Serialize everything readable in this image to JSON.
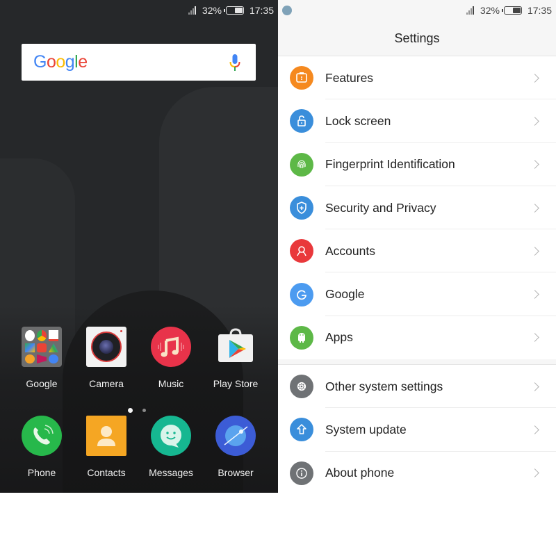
{
  "home": {
    "status": {
      "battery": "32%",
      "battery_level": 0.32,
      "time": "17:35"
    },
    "search": {
      "logo": [
        "G",
        "o",
        "o",
        "g",
        "l",
        "e"
      ],
      "logo_colors": [
        "#4285F4",
        "#EA4335",
        "#FBBC05",
        "#4285F4",
        "#34A853",
        "#EA4335"
      ]
    },
    "apps_row1": [
      {
        "label": "Google",
        "icon": "google-folder-icon"
      },
      {
        "label": "Camera",
        "icon": "camera-icon"
      },
      {
        "label": "Music",
        "icon": "music-icon"
      },
      {
        "label": "Play Store",
        "icon": "play-store-icon"
      }
    ],
    "page_indicator": {
      "current": 1,
      "total": 2
    },
    "dock": [
      {
        "label": "Phone",
        "icon": "phone-icon"
      },
      {
        "label": "Contacts",
        "icon": "contacts-icon"
      },
      {
        "label": "Messages",
        "icon": "messages-icon"
      },
      {
        "label": "Browser",
        "icon": "browser-icon"
      }
    ]
  },
  "settings": {
    "status": {
      "battery": "32%",
      "battery_level": 0.32,
      "time": "17:35"
    },
    "title": "Settings",
    "group1": [
      {
        "label": "Features",
        "icon": "features-icon",
        "color": "#F5891F"
      },
      {
        "label": "Lock screen",
        "icon": "lock-icon",
        "color": "#3A8EDB"
      },
      {
        "label": "Fingerprint Identification",
        "icon": "fingerprint-icon",
        "color": "#5DB847"
      },
      {
        "label": "Security and Privacy",
        "icon": "shield-icon",
        "color": "#3A8EDB"
      },
      {
        "label": "Accounts",
        "icon": "account-icon",
        "color": "#E9383B"
      },
      {
        "label": "Google",
        "icon": "google-g-icon",
        "color": "#4C9BF0"
      },
      {
        "label": "Apps",
        "icon": "android-icon",
        "color": "#5DB847"
      }
    ],
    "group2": [
      {
        "label": "Other system settings",
        "icon": "gear-icon",
        "color": "#6F7275"
      },
      {
        "label": "System update",
        "icon": "upload-arrow-icon",
        "color": "#3A8EDB"
      },
      {
        "label": "About phone",
        "icon": "info-icon",
        "color": "#6F7275"
      }
    ]
  }
}
